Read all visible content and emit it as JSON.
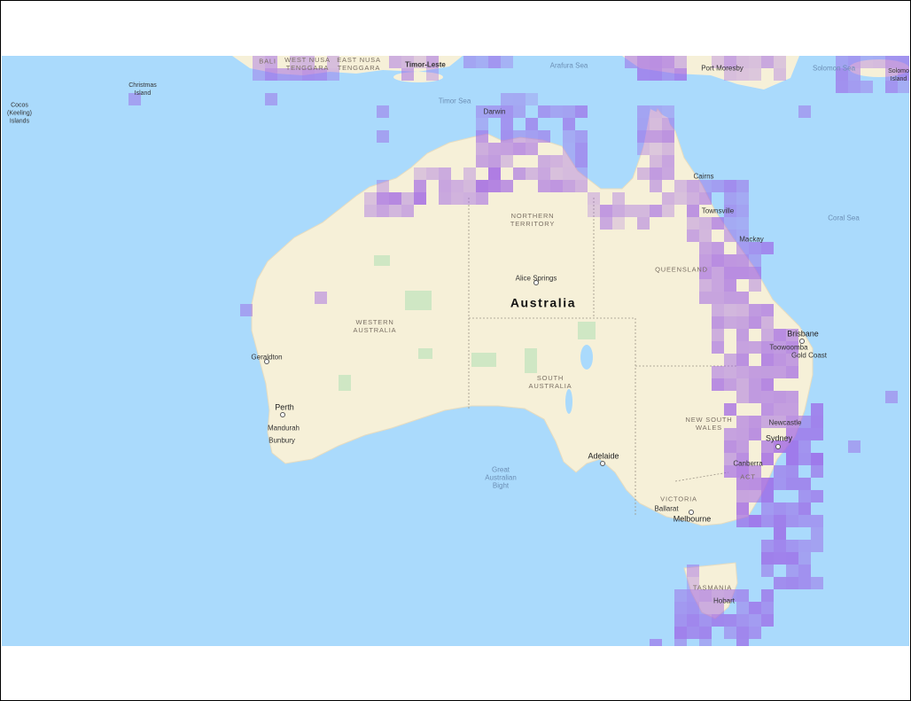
{
  "colors": {
    "ocean": "#aadafc",
    "land": "#f6f0d8",
    "park": "#cfe7c4",
    "grid_cell": "#9b5de5"
  },
  "labels": {
    "christmas_island": "Christmas\nIsland",
    "cocos_islands": "Cocos\n(Keeling)\nIslands",
    "bali": "BALI",
    "west_nusa_tenggara": "WEST NUSA\nTENGGARA",
    "east_nusa_tenggara": "EAST NUSA\nTENGGARA",
    "timor_leste": "Timor-Leste",
    "arafura_sea": "Arafura Sea",
    "port_moresby": "Port Moresby",
    "solomon_sea": "Solomon Sea",
    "solomon_islands": "Solomo\nIsland",
    "timor_sea": "Timor Sea",
    "darwin": "Darwin",
    "cairns": "Cairns",
    "townsville": "Townsville",
    "mackay": "Mackay",
    "coral_sea": "Coral Sea",
    "northern_territory": "NORTHERN\nTERRITORY",
    "queensland": "QUEENSLAND",
    "alice_springs": "Alice Springs",
    "australia": "Australia",
    "western_australia": "WESTERN\nAUSTRALIA",
    "geraldton": "Geraldton",
    "south_australia": "SOUTH\nAUSTRALIA",
    "brisbane": "Brisbane",
    "toowoomba": "Toowoomba",
    "gold_coast": "Gold Coast",
    "perth": "Perth",
    "mandurah": "Mandurah",
    "bunbury": "Bunbury",
    "new_south_wales": "NEW SOUTH\nWALES",
    "newcastle": "Newcastle",
    "sydney": "Sydney",
    "adelaide": "Adelaide",
    "great_australian_bight": "Great\nAustralian\nBight",
    "canberra": "Canberra",
    "act": "ACT",
    "victoria": "VICTORIA",
    "ballarat": "Ballarat",
    "melbourne": "Melbourne",
    "tasmania": "TASMANIA",
    "hobart": "Hobart"
  }
}
